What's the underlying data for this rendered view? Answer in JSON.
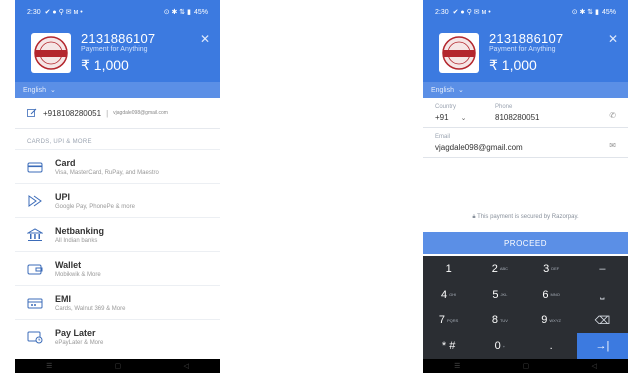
{
  "left": {
    "status": {
      "time": "2:30",
      "battery": "45%"
    },
    "merchant": {
      "id": "2131886107",
      "desc": "Payment for Anything",
      "amount": "₹ 1,000"
    },
    "language": "English",
    "contact": {
      "phone": "+918108280051",
      "email": "vjagdale098@gmail.com"
    },
    "section_title": "CARDS, UPI & MORE",
    "methods": [
      {
        "title": "Card",
        "sub": "Visa, MasterCard, RuPay, and Maestro",
        "icon": "card-icon"
      },
      {
        "title": "UPI",
        "sub": "Google Pay, PhonePe & more",
        "icon": "upi-icon"
      },
      {
        "title": "Netbanking",
        "sub": "All Indian banks",
        "icon": "bank-icon"
      },
      {
        "title": "Wallet",
        "sub": "Mobikwik & More",
        "icon": "wallet-icon"
      },
      {
        "title": "EMI",
        "sub": "Cards, Walnut 369 & More",
        "icon": "emi-icon"
      },
      {
        "title": "Pay Later",
        "sub": "ePayLater & More",
        "icon": "paylater-icon"
      }
    ]
  },
  "right": {
    "status": {
      "time": "2:30",
      "battery": "45%"
    },
    "merchant": {
      "id": "2131886107",
      "desc": "Payment for Anything",
      "amount": "₹ 1,000"
    },
    "language": "English",
    "form": {
      "country_label": "Country",
      "country_value": "+91",
      "phone_label": "Phone",
      "phone_value": "8108280051",
      "email_label": "Email",
      "email_value": "vjagdale098@gmail.com"
    },
    "secure_note": "This payment is secured by Razorpay.",
    "proceed": "PROCEED",
    "keys": [
      {
        "d": "1",
        "l": ""
      },
      {
        "d": "2",
        "l": "ABC"
      },
      {
        "d": "3",
        "l": "DEF"
      },
      {
        "d": "–",
        "l": ""
      },
      {
        "d": "4",
        "l": "GHI"
      },
      {
        "d": "5",
        "l": "JKL"
      },
      {
        "d": "6",
        "l": "MNO"
      },
      {
        "d": "⎵",
        "l": ""
      },
      {
        "d": "7",
        "l": "PQRS"
      },
      {
        "d": "8",
        "l": "TUV"
      },
      {
        "d": "9",
        "l": "WXYZ"
      },
      {
        "d": "⌫",
        "l": ""
      },
      {
        "d": "* #",
        "l": ""
      },
      {
        "d": "0",
        "l": "+"
      },
      {
        "d": ".",
        "l": ""
      },
      {
        "d": "→|",
        "l": ""
      }
    ]
  },
  "brand_color": "#3c7ae0"
}
